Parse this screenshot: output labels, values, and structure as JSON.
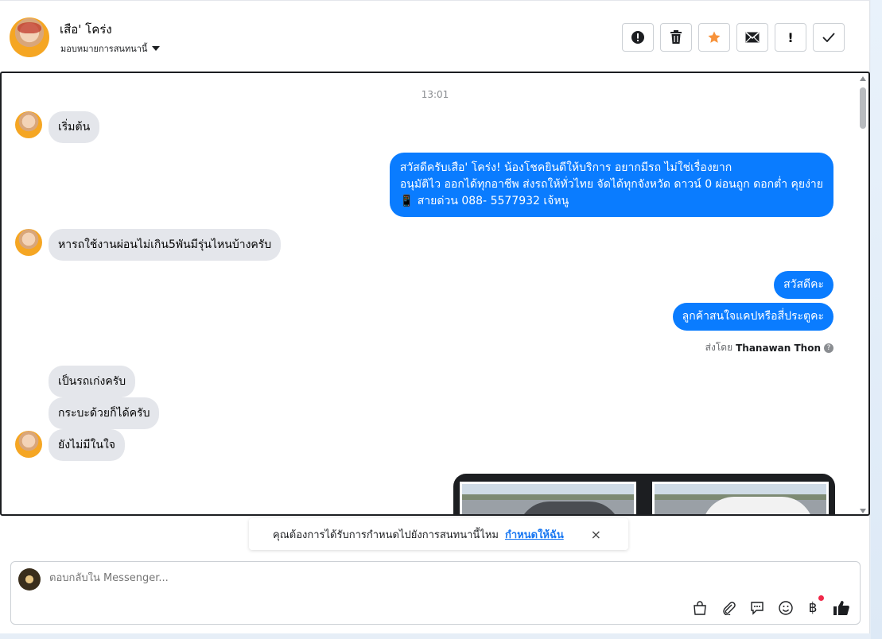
{
  "header": {
    "contact_name": "เสือ' โคร่ง",
    "assign_label": "มอบหมายการสนทนานี้",
    "buttons": {
      "spam_icon": "exclamation-circle-icon",
      "delete_icon": "trash-icon",
      "star_icon": "star-icon",
      "mail_icon": "envelope-icon",
      "followup_icon": "exclamation-icon",
      "done_icon": "check-icon"
    }
  },
  "chat": {
    "timestamp": "13:01",
    "messages": [
      {
        "dir": "in",
        "text": "เริ่มต้น"
      },
      {
        "dir": "out",
        "lines": [
          "สวัสดีครับเสือ' โคร่ง! น้องโชคยินดีให้บริการ อยากมีรถ ไม่ใช่เรื่องยาก",
          "อนุมัติไว ออกได้ทุกอาชีพ ส่งรถให้ทั่วไทย จัดได้ทุกจังหวัด ดาวน์ 0  ผ่อนถูก ดอกต่ำ คุยง่าย",
          "📱 สายด่วน 088- 5577932 เจ้หนู"
        ]
      },
      {
        "dir": "in",
        "text": "หารถใช้งานผ่อนไม่เกิน5พันมีรุ่นไหนบ้างครับ"
      },
      {
        "dir": "out",
        "text": "สวัสดีคะ"
      },
      {
        "dir": "out",
        "text": "ลูกค้าสนใจแคปหรือสี่ประตูคะ"
      },
      {
        "dir": "in",
        "text": "เป็นรถเก่งครับ"
      },
      {
        "dir": "in",
        "text": "กระบะด้วยก็ได้ครับ"
      },
      {
        "dir": "in",
        "text": "ยังไม่มีในใจ"
      }
    ],
    "sent_by_prefix": "ส่งโดย",
    "sent_by_name": "Thanawan Thon",
    "help_mark": "?"
  },
  "suggestion": {
    "text": "คุณต้องการได้รับการกำหนดไปยังการสนทนานี้ไหม",
    "link": "กำหนดให้ฉัน",
    "close": "×"
  },
  "composer": {
    "placeholder": "ตอบกลับใน Messenger...",
    "tools": [
      "bag-icon",
      "paperclip-icon",
      "chat-bubble-icon",
      "smiley-icon",
      "baht-icon",
      "thumbs-up-icon"
    ],
    "accent": "#0a7cff"
  }
}
